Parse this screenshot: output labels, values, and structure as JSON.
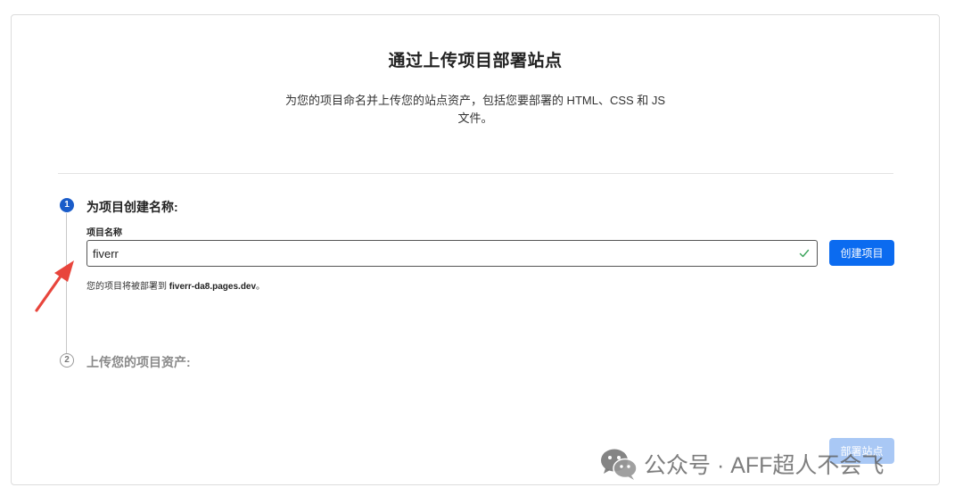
{
  "header": {
    "title": "通过上传项目部署站点",
    "description_line1": "为您的项目命名并上传您的站点资产，包括您要部署的 HTML、CSS 和 JS",
    "description_line2": "文件。"
  },
  "step1": {
    "number": "1",
    "title": "为项目创建名称:",
    "field_label": "项目名称",
    "input_value": "fiverr",
    "create_button_label": "创建项目",
    "hint_prefix": "您的项目将被部署到 ",
    "hint_domain": "fiverr-da8.pages.dev",
    "hint_suffix": "。"
  },
  "step2": {
    "number": "2",
    "title": "上传您的项目资产:"
  },
  "footer": {
    "deploy_button_label": "部署站点"
  },
  "watermark": {
    "text": "公众号 · AFF超人不会飞"
  },
  "colors": {
    "primary": "#0b6bf0",
    "primary_disabled": "#a9c8f5",
    "step_active": "#1a5cc9",
    "valid_check": "#3aa35a",
    "annotation_arrow": "#e8453c"
  }
}
